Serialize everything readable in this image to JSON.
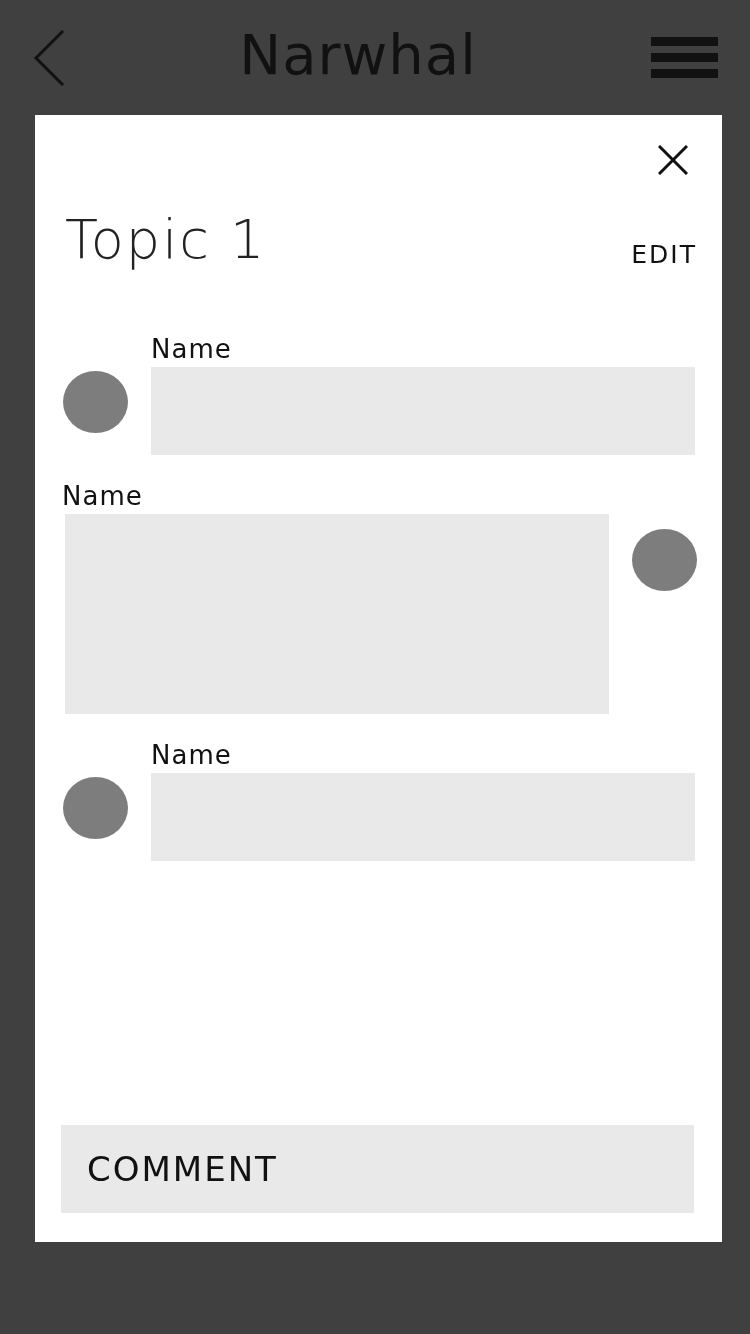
{
  "header": {
    "title": "Narwhal"
  },
  "card": {
    "title": "Topic 1",
    "edit_label": "EDIT",
    "messages": [
      {
        "kind": "incoming",
        "name": "Name"
      },
      {
        "kind": "outgoing",
        "name": "Name"
      },
      {
        "kind": "incoming",
        "name": "Name"
      }
    ],
    "comment": {
      "placeholder": "COMMENT"
    }
  }
}
